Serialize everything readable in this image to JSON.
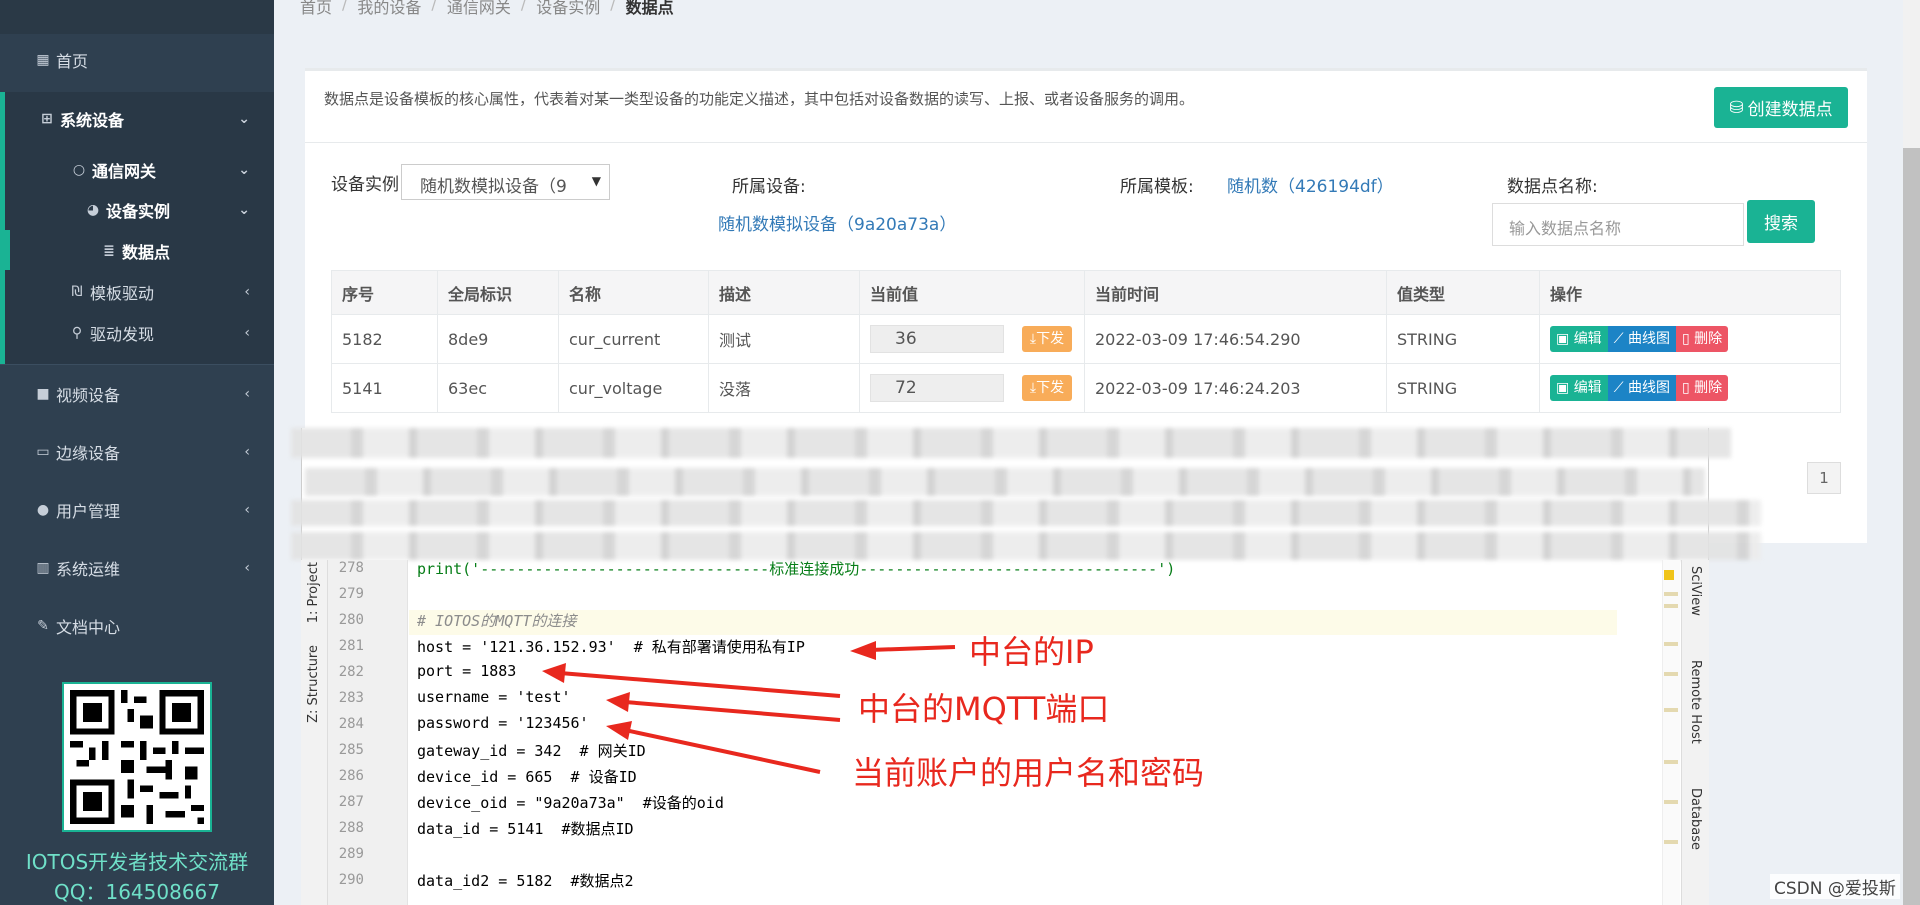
{
  "sidebar": {
    "items": [
      {
        "label": "首页",
        "icon": "grid-icon",
        "chevron": ""
      },
      {
        "label": "系统设备",
        "icon": "sitemap-icon",
        "chevron": "⌄"
      },
      {
        "label": "通信网关",
        "icon": "circle-icon",
        "chevron": "⌄"
      },
      {
        "label": "设备实例",
        "icon": "palette-icon",
        "chevron": "⌄"
      },
      {
        "label": "数据点",
        "icon": "database-icon",
        "chevron": ""
      },
      {
        "label": "模板驱动",
        "icon": "drive-icon",
        "chevron": "‹"
      },
      {
        "label": "驱动发现",
        "icon": "plug-icon",
        "chevron": "‹"
      },
      {
        "label": "视频设备",
        "icon": "video-icon",
        "chevron": "‹"
      },
      {
        "label": "边缘设备",
        "icon": "laptop-icon",
        "chevron": "‹"
      },
      {
        "label": "用户管理",
        "icon": "user-icon",
        "chevron": "‹"
      },
      {
        "label": "系统运维",
        "icon": "bar-chart-icon",
        "chevron": "‹"
      },
      {
        "label": "文档中心",
        "icon": "edit-icon",
        "chevron": ""
      }
    ],
    "qq_title": "IOTOS开发者技术交流群",
    "qq_number": "QQ：164508667"
  },
  "breadcrumb": [
    "首页",
    "我的设备",
    "通信网关",
    "设备实例",
    "数据点"
  ],
  "description": "数据点是设备模板的核心属性，代表着对某一类型设备的功能定义描述，其中包括对设备数据的读写、上报、或者设备服务的调用。",
  "create_button": "创建数据点",
  "filters": {
    "instance_label": "设备实例",
    "instance_value": "随机数模拟设备（9",
    "device_label": "所属设备:",
    "device_link": "随机数模拟设备（9a20a73a）",
    "template_label": "所属模板:",
    "template_link": "随机数（426194df）",
    "name_label": "数据点名称:",
    "name_placeholder": "输入数据点名称",
    "search_button": "搜索"
  },
  "table": {
    "headers": [
      "序号",
      "全局标识",
      "名称",
      "描述",
      "当前值",
      "当前时间",
      "值类型",
      "操作"
    ],
    "rows": [
      {
        "id": "5182",
        "gid": "8de9",
        "name": "cur_current",
        "desc": "测试",
        "value": "36",
        "time": "2022-03-09 17:46:54.290",
        "type": "STRING"
      },
      {
        "id": "5141",
        "gid": "63ec",
        "name": "cur_voltage",
        "desc": "没落",
        "value": "72",
        "time": "2022-03-09 17:46:24.203",
        "type": "STRING"
      }
    ],
    "send_label": "下发",
    "edit_label": "编辑",
    "chart_label": "曲线图",
    "delete_label": "删除"
  },
  "pagination": {
    "current": "1"
  },
  "ide": {
    "left_tabs": [
      "1: Project",
      "Z: Structure"
    ],
    "right_tabs": [
      "SciView",
      "Remote Host",
      "Database"
    ],
    "lines": [
      {
        "n": "278",
        "code": "print('--------------------------------标准连接成功---------------------------------')"
      },
      {
        "n": "279",
        "code": ""
      },
      {
        "n": "280",
        "code": "# IOTOS的MQTT的连接"
      },
      {
        "n": "281",
        "code": "host = '121.36.152.93'  # 私有部署请使用私有IP"
      },
      {
        "n": "282",
        "code": "port = 1883"
      },
      {
        "n": "283",
        "code": "username = 'test'"
      },
      {
        "n": "284",
        "code": "password = '123456'"
      },
      {
        "n": "285",
        "code": "gateway_id = 342  # 网关ID"
      },
      {
        "n": "286",
        "code": "device_id = 665  # 设备ID"
      },
      {
        "n": "287",
        "code": "device_oid = \"9a20a73a\"  #设备的oid"
      },
      {
        "n": "288",
        "code": "data_id = 5141  #数据点ID"
      },
      {
        "n": "289",
        "code": ""
      },
      {
        "n": "290",
        "code": "data_id2 = 5182  #数据点2"
      }
    ]
  },
  "annotations": {
    "ip": "中台的IP",
    "mqtt_port": "中台的MQTT端口",
    "credentials": "当前账户的用户名和密码"
  },
  "watermark": "CSDN @爱投斯",
  "colors": {
    "sidebar_bg": "#2f4050",
    "accent": "#1ab394",
    "link": "#337ab7",
    "warning": "#f8ac59",
    "danger": "#ed5565",
    "annotation": "#e8281e"
  }
}
